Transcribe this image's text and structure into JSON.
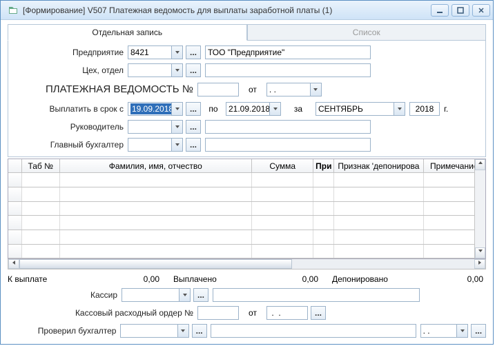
{
  "window": {
    "title": "[Формирование] V507 Платежная ведомость для выплаты заработной платы (1)"
  },
  "tabs": {
    "single": "Отдельная запись",
    "list": "Список"
  },
  "labels": {
    "enterprise": "Предприятие",
    "dept": "Цех, отдел",
    "heading": "ПЛАТЕЖНАЯ ВЕДОМОСТЬ №",
    "from": "от",
    "pay_by": "Выплатить в срок с",
    "to": "по",
    "for": "за",
    "year_suffix": "г.",
    "manager": "Руководитель",
    "chief_acc": "Главный бухгалтер",
    "to_pay": "К выплате",
    "paid": "Выплачено",
    "deposited": "Депонировано",
    "cashier": "Кассир",
    "cash_order": "Кассовый расходный ордер №",
    "checked": "Проверил бухгалтер",
    "date_placeholder": " .  . "
  },
  "fields": {
    "enterprise_code": "8421",
    "enterprise_name": "ТОО \"Предприятие\"",
    "dept_code": "",
    "dept_name": "",
    "doc_no": "",
    "doc_date": " .  . ",
    "date_from": "19.09.2018",
    "date_to": "21.09.2018",
    "month": "СЕНТЯБРЬ",
    "year": "2018",
    "manager_code": "",
    "manager_name": "",
    "chief_code": "",
    "chief_name": "",
    "cashier_code": "",
    "cashier_name": "",
    "order_no": "",
    "order_date": " .  . ",
    "checked_code": "",
    "checked_name": "",
    "checked_date": " .  . "
  },
  "sums": {
    "to_pay": "0,00",
    "paid": "0,00",
    "deposited": "0,00"
  },
  "grid": {
    "columns": {
      "tab": "Таб №",
      "fio": "Фамилия, имя, отчество",
      "sum": "Сумма",
      "pri": "При",
      "dep": "Признак 'депонирова",
      "note": "Примечание"
    },
    "rows": []
  }
}
